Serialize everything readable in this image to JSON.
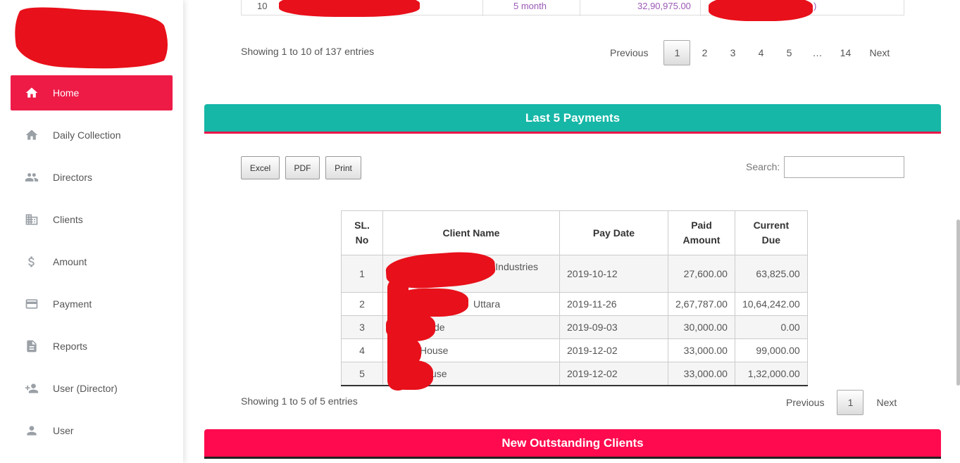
{
  "sidebar": {
    "items": [
      {
        "label": "Home",
        "icon": "home-icon"
      },
      {
        "label": "Daily Collection",
        "icon": "home-icon"
      },
      {
        "label": "Directors",
        "icon": "people-icon"
      },
      {
        "label": "Clients",
        "icon": "building-icon"
      },
      {
        "label": "Amount",
        "icon": "dollar-icon"
      },
      {
        "label": "Payment",
        "icon": "credit-card-icon"
      },
      {
        "label": "Reports",
        "icon": "document-icon"
      },
      {
        "label": "User (Director)",
        "icon": "add-user-icon"
      },
      {
        "label": "User",
        "icon": "person-icon"
      }
    ]
  },
  "top_table": {
    "sl": "10",
    "duration": "5 month",
    "amount": "32,90,975.00",
    "suffix": ")"
  },
  "top_pager": {
    "info": "Showing 1 to 10 of 137 entries",
    "previous": "Previous",
    "pages": [
      "1",
      "2",
      "3",
      "4",
      "5",
      "…",
      "14"
    ],
    "next": "Next"
  },
  "payments": {
    "title": "Last 5 Payments",
    "buttons": {
      "excel": "Excel",
      "pdf": "PDF",
      "print": "Print"
    },
    "search_label": "Search:",
    "columns": [
      "SL. No",
      "Client Name",
      "Pay Date",
      "Paid Amount",
      "Current Due"
    ],
    "rows": [
      {
        "sl": "1",
        "client": "Industries",
        "date": "2019-10-12",
        "paid": "27,600.00",
        "due": "63,825.00"
      },
      {
        "sl": "2",
        "client": "Uttara",
        "date": "2019-11-26",
        "paid": "2,67,787.00",
        "due": "10,64,242.00"
      },
      {
        "sl": "3",
        "client": "de",
        "date": "2019-09-03",
        "paid": "30,000.00",
        "due": "0.00"
      },
      {
        "sl": "4",
        "client": "House",
        "date": "2019-12-02",
        "paid": "33,000.00",
        "due": "99,000.00"
      },
      {
        "sl": "5",
        "client": "use",
        "date": "2019-12-02",
        "paid": "33,000.00",
        "due": "1,32,000.00"
      }
    ],
    "info": "Showing 1 to 5 of 5 entries",
    "previous": "Previous",
    "page": "1",
    "next": "Next"
  },
  "outstanding": {
    "title": "New Outstanding Clients"
  },
  "colors": {
    "accent_red": "#ee1b47",
    "teal": "#16b7a7",
    "header_red": "#ff0a4e",
    "purple_text": "#9b59b6"
  }
}
